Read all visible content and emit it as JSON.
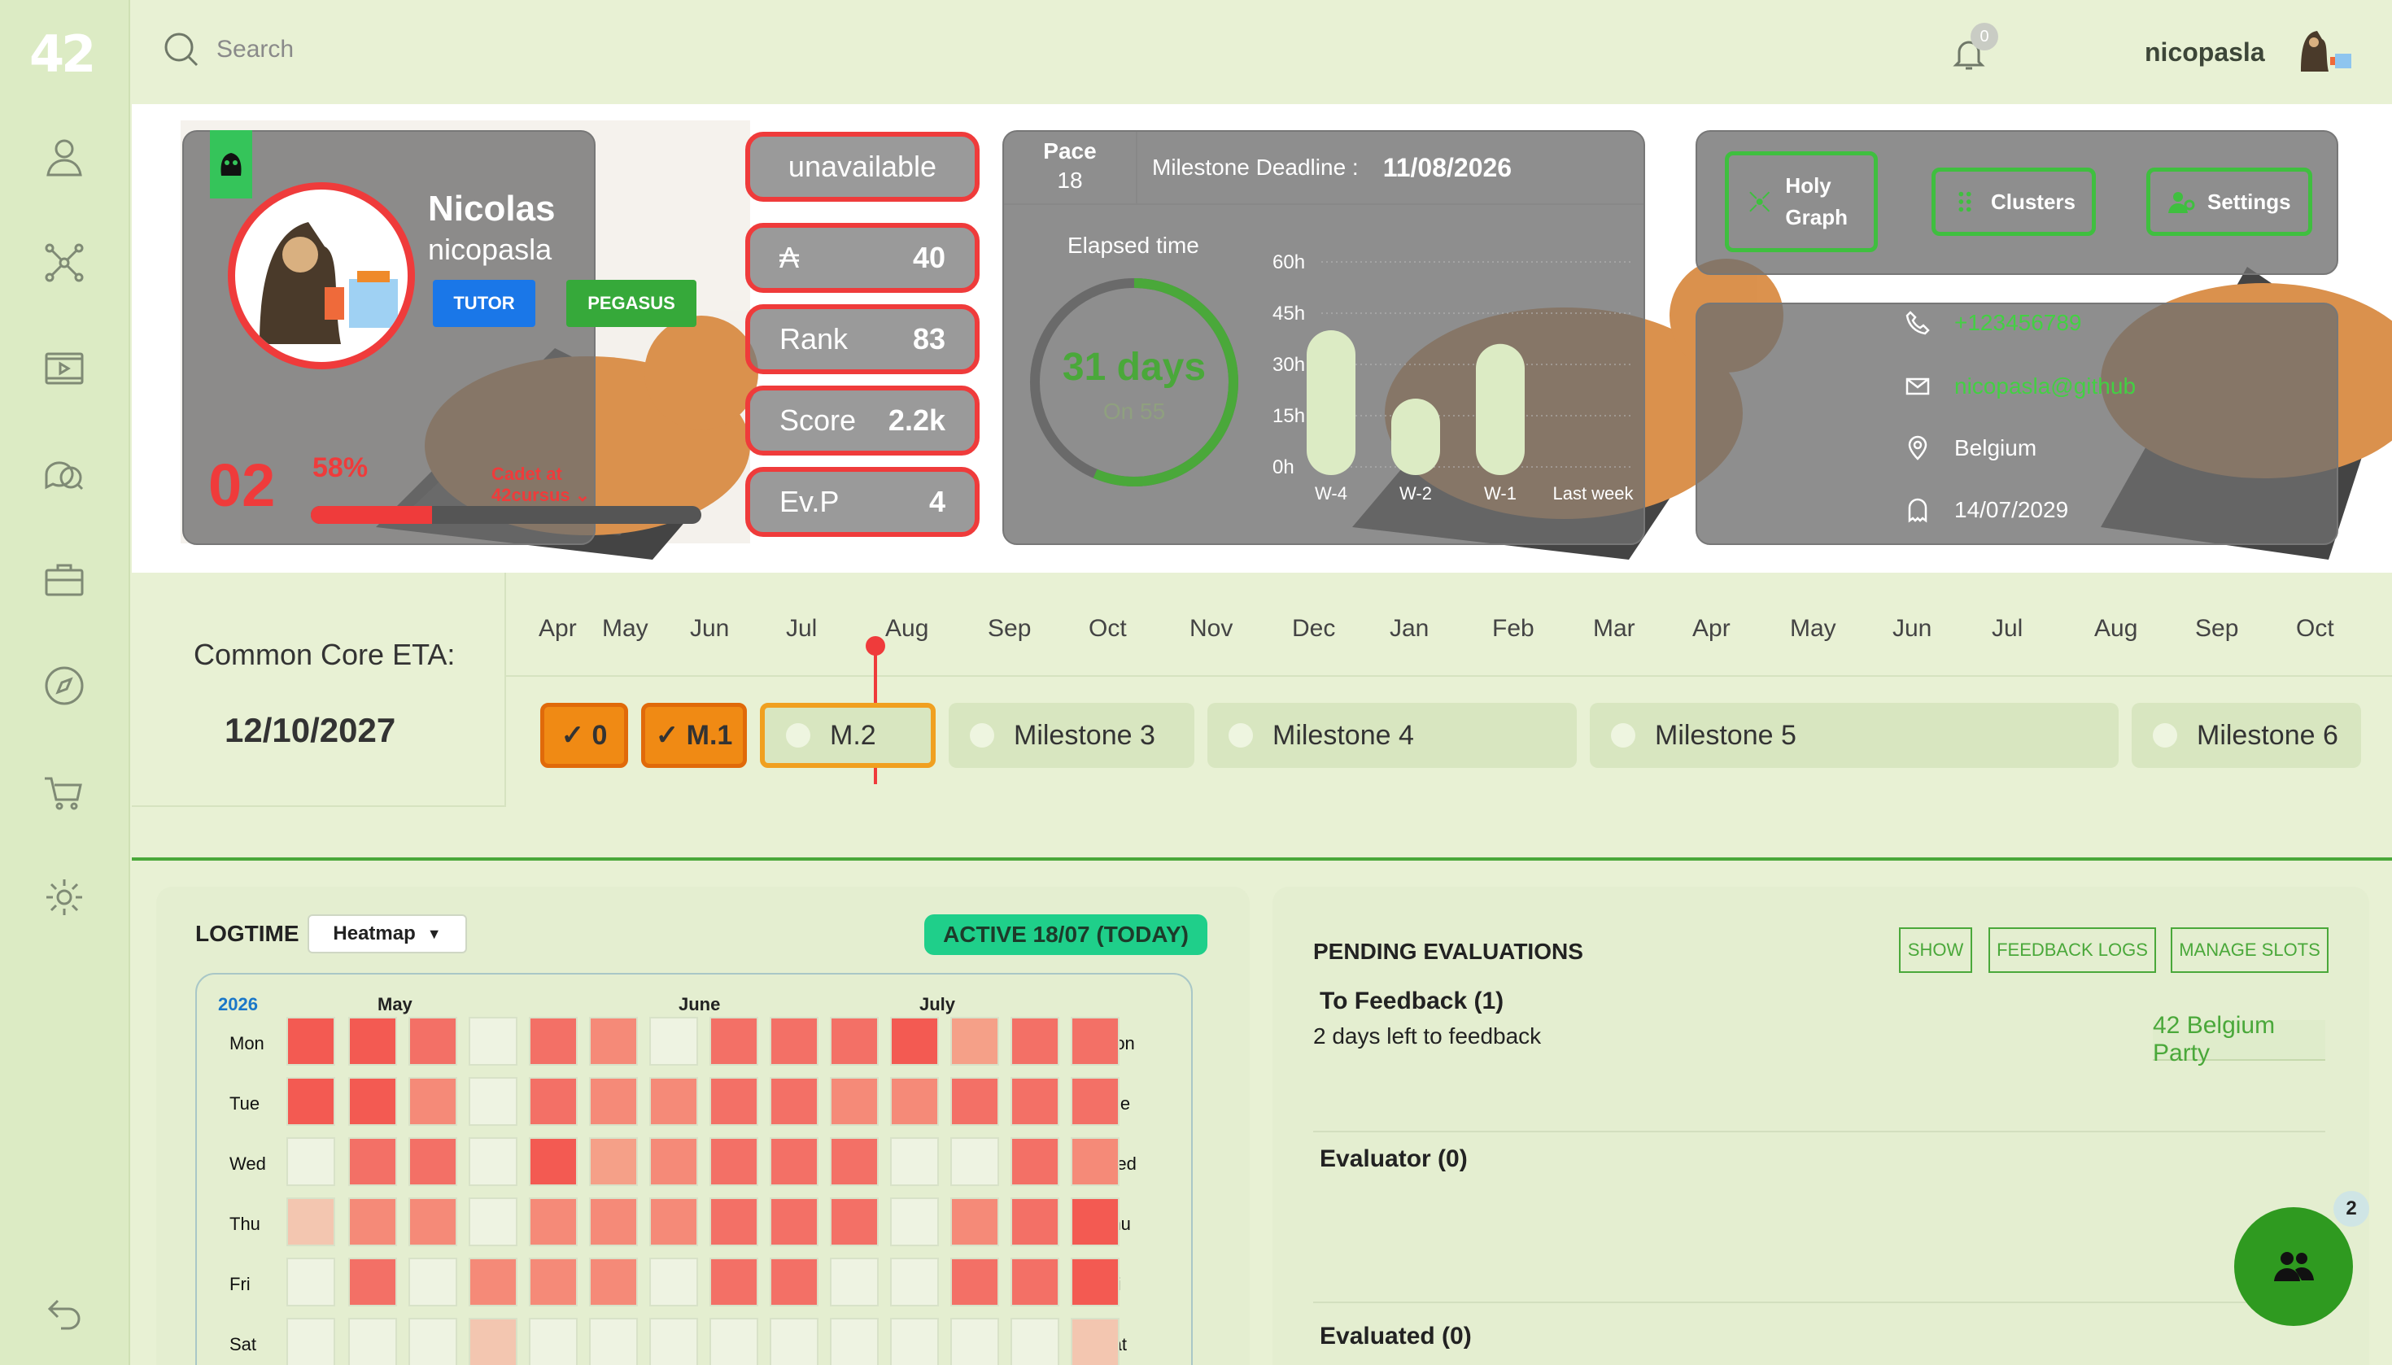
{
  "brand": {
    "logo": "42"
  },
  "search": {
    "placeholder": "Search"
  },
  "header": {
    "notifications": "0",
    "username": "nicopasla"
  },
  "profile": {
    "name": "Nicolas",
    "login": "nicopasla",
    "tags": [
      "TUTOR",
      "PEGASUS"
    ],
    "level": "02",
    "level_progress_label": "58%",
    "level_progress": 0.31,
    "cursus": "Cadet at 42cursus ⌄"
  },
  "status": "unavailable",
  "stats": [
    {
      "label": "₳",
      "value": "40"
    },
    {
      "label": "Rank",
      "value": "83"
    },
    {
      "label": "Score",
      "value": "2.2k"
    },
    {
      "label": "Ev.P",
      "value": "4"
    }
  ],
  "pace": {
    "label": "Pace",
    "value": "18"
  },
  "milestone": {
    "label": "Milestone Deadline :",
    "date": "11/08/2026"
  },
  "elapsed": {
    "title": "Elapsed time",
    "value": "31 days",
    "sub": "On 55",
    "fraction": 0.564
  },
  "chart_data": {
    "type": "bar",
    "categories": [
      "W-4",
      "W-2",
      "W-1",
      "Last week"
    ],
    "values": [
      40,
      20,
      36,
      0
    ],
    "ylim": [
      0,
      60
    ],
    "yticks": [
      "0h",
      "15h",
      "30h",
      "45h",
      "60h"
    ],
    "grid": true
  },
  "actions": [
    "Holy Graph",
    "Clusters",
    "Settings"
  ],
  "contact": {
    "phone": "+123456789",
    "email": "nicopasla@github",
    "location": "Belgium",
    "date": "14/07/2029"
  },
  "eta": {
    "label": "Common Core ETA:",
    "date": "12/10/2027",
    "months": [
      "Apr",
      "May",
      "Jun",
      "Jul",
      "Aug",
      "Sep",
      "Oct",
      "Nov",
      "Dec",
      "Jan",
      "Feb",
      "Mar",
      "Apr",
      "May",
      "Jun",
      "Jul",
      "Aug",
      "Sep",
      "Oct"
    ],
    "milestones": [
      {
        "label": "✓ 0",
        "state": "done"
      },
      {
        "label": "✓ M.1",
        "state": "done"
      },
      {
        "label": "M.2",
        "state": "current"
      },
      {
        "label": "Milestone 3",
        "state": "todo"
      },
      {
        "label": "Milestone 4",
        "state": "todo"
      },
      {
        "label": "Milestone 5",
        "state": "todo"
      },
      {
        "label": "Milestone 6",
        "state": "todo"
      }
    ]
  },
  "logtime": {
    "title": "LOGTIME",
    "view": "Heatmap",
    "active": "ACTIVE 18/07 (TODAY)",
    "year": "2026",
    "months": [
      "May",
      "June",
      "July"
    ],
    "days": [
      "Mon",
      "Tue",
      "Wed",
      "Thu",
      "Fri",
      "Sat"
    ],
    "levels": [
      [
        5,
        5,
        4,
        0,
        4,
        3,
        0,
        4,
        4,
        4,
        5,
        2,
        4,
        4
      ],
      [
        5,
        5,
        3,
        0,
        4,
        3,
        3,
        4,
        4,
        3,
        3,
        4,
        4,
        4
      ],
      [
        0,
        4,
        4,
        0,
        5,
        2,
        3,
        4,
        4,
        4,
        0,
        0,
        4,
        3
      ],
      [
        1,
        3,
        3,
        0,
        3,
        3,
        3,
        4,
        4,
        4,
        0,
        3,
        4,
        5
      ],
      [
        0,
        4,
        0,
        3,
        3,
        3,
        0,
        4,
        4,
        0,
        0,
        4,
        4,
        5
      ],
      [
        0,
        0,
        0,
        1,
        0,
        0,
        0,
        0,
        0,
        0,
        0,
        0,
        0,
        1
      ]
    ],
    "colors": [
      "#eef3e2",
      "#f3c6b0",
      "#f5a088",
      "#f58a78",
      "#f37066",
      "#f35a52"
    ]
  },
  "evaluations": {
    "title": "PENDING EVALUATIONS",
    "buttons": [
      "SHOW",
      "FEEDBACK LOGS",
      "MANAGE SLOTS"
    ],
    "to_feedback": "To Feedback (1)",
    "days_left": "2 days left to feedback",
    "party": "42 Belgium Party",
    "evaluator": "Evaluator (0)",
    "evaluated": "Evaluated (0)"
  },
  "fab": {
    "badge": "2"
  }
}
